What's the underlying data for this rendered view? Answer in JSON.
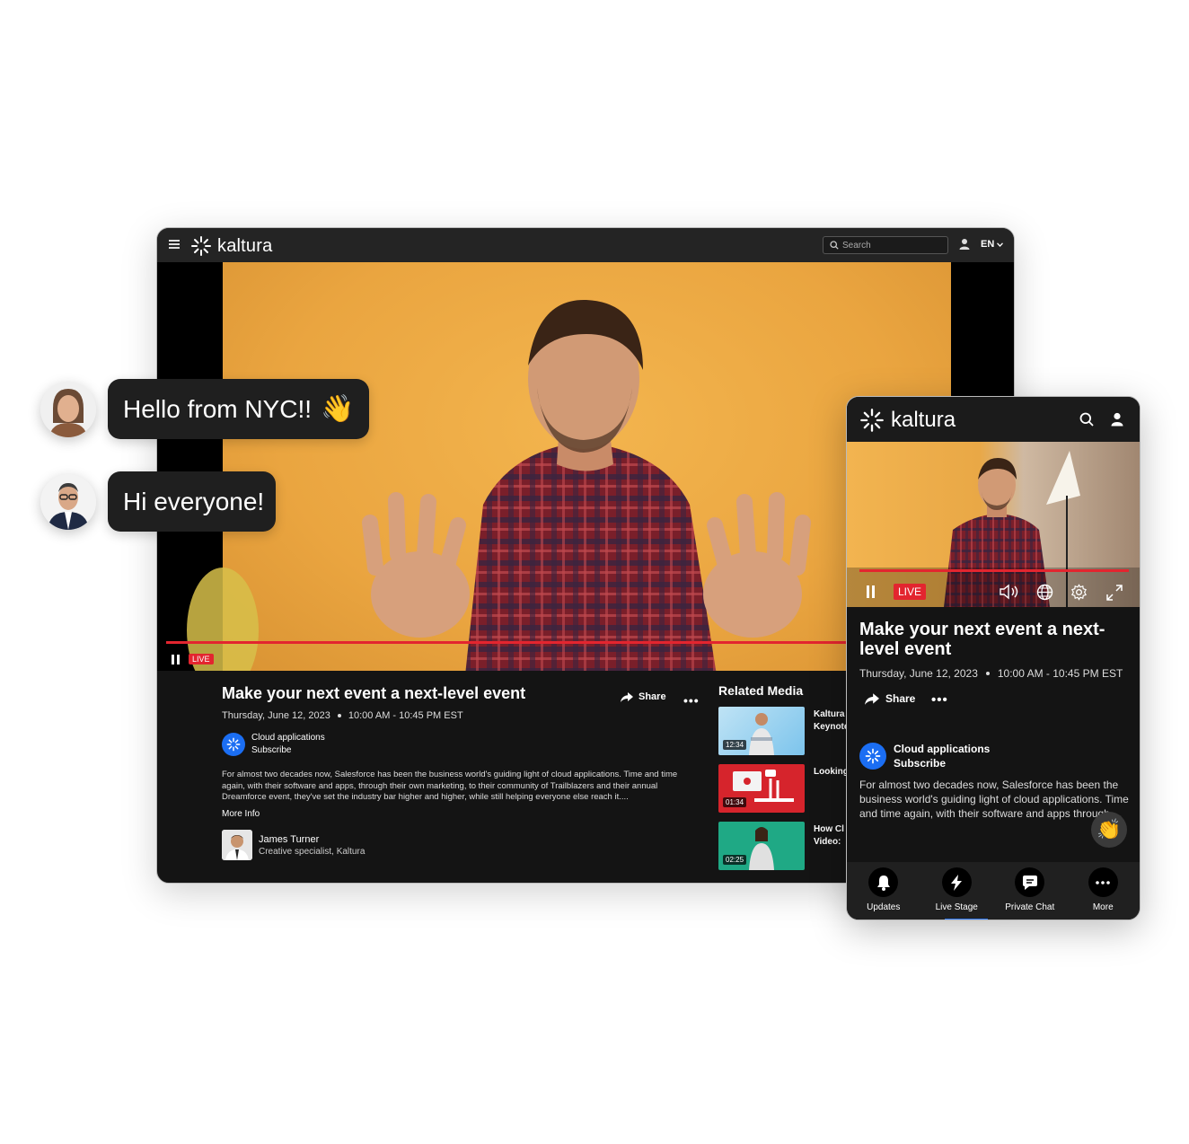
{
  "brand": {
    "name": "kaltura"
  },
  "desktop": {
    "search": {
      "placeholder": "Search"
    },
    "language": "EN",
    "player": {
      "live_label": "LIVE",
      "progress": 1.0
    },
    "event": {
      "title": "Make your next event a next-level event",
      "date": "Thursday, June 12, 2023",
      "time": "10:00 AM - 10:45 PM EST",
      "share_label": "Share",
      "more_label": "•••"
    },
    "channel": {
      "name": "Cloud applications",
      "action": "Subscribe"
    },
    "description": "For almost two decades now, Salesforce has been the business world's guiding light of cloud applications. Time and time again, with their software and apps, through their own marketing, to their community of Trailblazers and their annual Dreamforce event, they've set the industry bar higher and higher, while still helping everyone else reach it....",
    "more_info": "More Info",
    "author": {
      "name": "James Turner",
      "role": "Creative specialist, Kaltura"
    },
    "related": {
      "title": "Related Media",
      "items": [
        {
          "duration": "12:34",
          "title": "Kaltura Keynote"
        },
        {
          "duration": "01:34",
          "title": "Looking"
        },
        {
          "duration": "02:25",
          "title": "How Cl Video: T"
        }
      ]
    }
  },
  "chat": [
    {
      "text": "Hello from NYC!!",
      "emoji": "👋"
    },
    {
      "text": "Hi everyone!"
    }
  ],
  "mobile": {
    "player": {
      "live_label": "LIVE"
    },
    "event": {
      "title": "Make your next event a next-level event",
      "date": "Thursday, June 12, 2023",
      "time": "10:00 AM - 10:45 PM EST",
      "share_label": "Share",
      "more_label": "•••"
    },
    "channel": {
      "name": "Cloud applications",
      "action": "Subscribe"
    },
    "description": "For almost two decades now, Salesforce has been the business world's guiding light of cloud applications. Time and time again, with their software and apps through ...",
    "reaction": "👏",
    "tabs": [
      {
        "label": "Updates",
        "icon": "bell-icon"
      },
      {
        "label": "Live Stage",
        "icon": "lightning-icon",
        "active": true
      },
      {
        "label": "Private Chat",
        "icon": "chat-icon"
      },
      {
        "label": "More",
        "icon": "more-icon"
      }
    ]
  },
  "colors": {
    "accent_red": "#e3252f",
    "brand_blue": "#1b6ef3",
    "tab_active": "#2f7af5"
  }
}
